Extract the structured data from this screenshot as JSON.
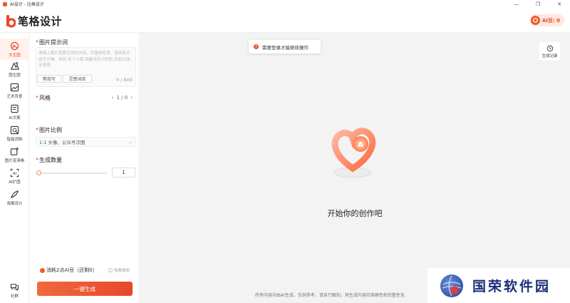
{
  "window": {
    "title": "AI设计 - 比格设计",
    "controls": [
      "—",
      "❐",
      "✕"
    ]
  },
  "header": {
    "logo_text": "笔格设计",
    "ai_badge": "AI豆: 0"
  },
  "nav": {
    "items": [
      {
        "label": "文生图",
        "icon": "text-to-image-icon",
        "active": true
      },
      {
        "label": "图生图",
        "icon": "image-to-image-icon"
      },
      {
        "label": "艺术背景",
        "icon": "art-background-icon"
      },
      {
        "label": "AI文案",
        "icon": "ai-copywriting-icon"
      },
      {
        "label": "智能消除",
        "icon": "smart-erase-icon"
      },
      {
        "label": "图片变清晰",
        "icon": "image-enhance-icon"
      },
      {
        "label": "AI扩图",
        "icon": "ai-expand-icon"
      },
      {
        "label": "海报设计",
        "icon": "poster-design-icon"
      }
    ],
    "community": "社群"
  },
  "panel": {
    "prompt_title": "图片提示词",
    "prompt_placeholder": "请输入图片需要呈现的内容，尽量用短语、使用英文逗号分隔。例如:多个小路,锦春花的小奶奶,风和日丽,全身照",
    "chip_help": "帮我写",
    "chip_inspiration": "灵感词库",
    "counter": "0 / 600",
    "style_title": "风格",
    "style_pager": "1 / 0",
    "ratio_title": "图片比例",
    "ratio_value": "1:1 头像、公众号次图",
    "count_title": "生成数量",
    "count_value": "1",
    "cost_text": "消耗2点AI豆（还剩0）",
    "free_text": "免费体验",
    "generate_label": "一键生成"
  },
  "main": {
    "toast": "需要登录才能继续操作",
    "history_label": "生成记录",
    "empty_text": "开始你的创作吧",
    "disclaimer": "所有内容均由AI生成，仅供参考，请自行甄别。其生成内容的准确性和完整性无"
  },
  "watermark": {
    "text": "国荣软件园"
  },
  "colors": {
    "accent": "#e8472a",
    "accent_light": "#fff1ec"
  }
}
